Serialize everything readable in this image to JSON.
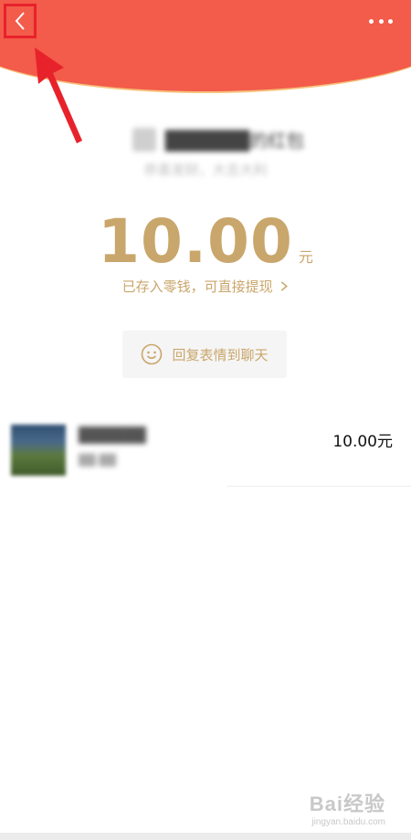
{
  "header": {
    "back_icon": "chevron-left-icon",
    "more_icon": "ellipsis-icon",
    "color": "#f35b4b",
    "highlight_color": "#e8222b"
  },
  "envelope": {
    "sender_name": "██████的红包",
    "greeting": "恭喜发财，大吉大利",
    "amount": "10.00",
    "unit": "元",
    "deposit_text": "已存入零钱，可直接提现",
    "accent_color": "#c9a66b"
  },
  "reply": {
    "label": "回复表情到聊天",
    "icon": "smile-icon"
  },
  "records": [
    {
      "name": "██████",
      "time": "██:██",
      "amount": "10.00元"
    }
  ],
  "watermark": {
    "brand": "Bai经验",
    "url": "jingyan.baidu.com"
  }
}
